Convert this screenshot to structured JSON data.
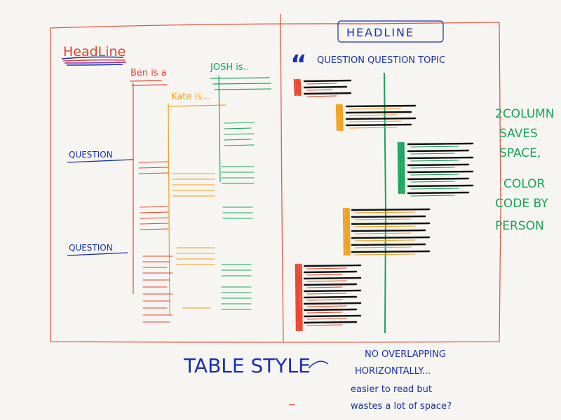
{
  "colors": {
    "frame": "#e05a4a",
    "blue": "#1a2fb0",
    "red": "#e8432e",
    "orange": "#f0a01c",
    "green": "#17a35a",
    "black": "#111111",
    "paper": "#f6f5f1"
  },
  "left_panel": {
    "headline": "HeadLine",
    "ben_label": "Ben is a",
    "josh_label": "JOSH is..",
    "kate_label": "Kate is...",
    "question_1": "QUESTION",
    "question_2": "QUESTION"
  },
  "right_panel": {
    "headline": "HEADLINE",
    "quote_mark": "“",
    "topic_line": "QUESTION QUESTION TOPIC"
  },
  "side_note": {
    "lines": [
      "2COLUMN",
      "SAVES",
      "SPACE,",
      "COLOR",
      "CODE BY",
      "PERSON"
    ]
  },
  "captions": {
    "table_style": "TABLE STYLE",
    "note_lines": [
      "NO OVERLAPPING",
      "HORIZONTALLY...",
      "easier to read but",
      "wastes a lot of space?"
    ]
  }
}
